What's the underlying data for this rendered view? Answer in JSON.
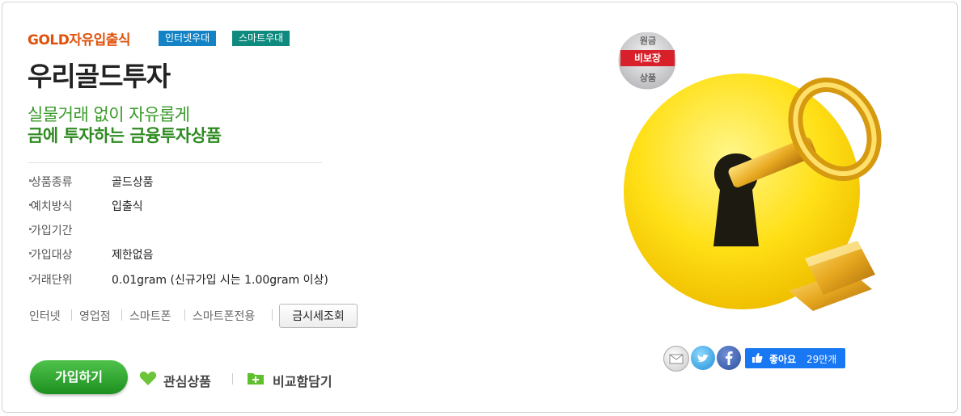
{
  "product": {
    "eyebrow": "GOLD자유입출식",
    "badges": [
      "인터넷우대",
      "스마트우대"
    ],
    "title": "우리골드투자",
    "subtitle_line1": "실물거래 없이 자유롭게",
    "subtitle_line2": "금에 투자하는 금융투자상품"
  },
  "info": [
    {
      "label": "상품종류",
      "value": "골드상품"
    },
    {
      "label": "예치방식",
      "value": "입출식"
    },
    {
      "label": "가입기간",
      "value": ""
    },
    {
      "label": "가입대상",
      "value": "제한없음"
    },
    {
      "label": "거래단위",
      "value": "0.01gram (신규가입 시는 1.00gram 이상)"
    }
  ],
  "channels": [
    "인터넷",
    "영업점",
    "스마트폰",
    "스마트폰전용"
  ],
  "buttons": {
    "gold_rate": "금시세조회",
    "join": "가입하기",
    "wishlist": "관심상품",
    "compare": "비교함담기"
  },
  "seal": {
    "line1": "원금",
    "line2": "비보장",
    "line3": "상품"
  },
  "social": {
    "icons": [
      "mail-icon",
      "twitter-icon",
      "facebook-icon"
    ],
    "like_label": "좋아요",
    "like_count": "29만개"
  },
  "colors": {
    "eyebrow": "#e0520c",
    "green": "#2f8a22",
    "badge_internet": "#1383c6",
    "badge_smart": "#0e8a7e",
    "join_button": "#1d8f21",
    "facebook": "#1877f2"
  }
}
